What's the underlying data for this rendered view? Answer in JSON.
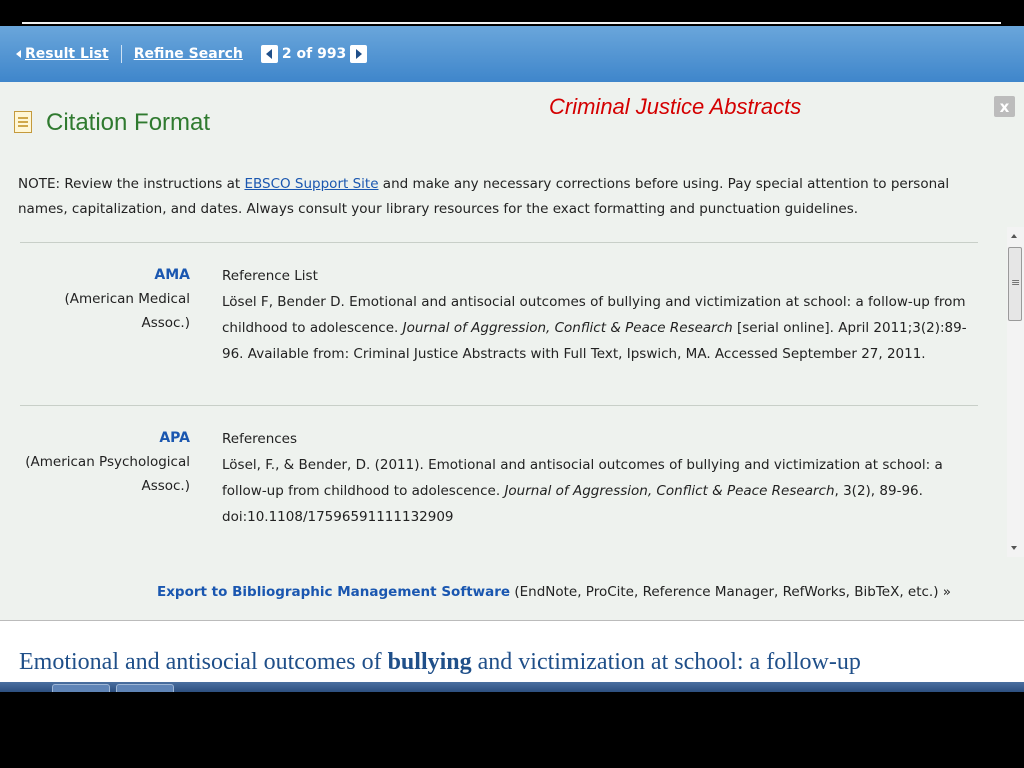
{
  "nav": {
    "result_list": "Result List",
    "refine_search": "Refine Search",
    "pager": "2 of 993"
  },
  "header": {
    "title": "Citation Format",
    "database": "Criminal Justice Abstracts",
    "close_label": "x"
  },
  "note": {
    "prefix": "NOTE: Review the instructions at ",
    "link": "EBSCO Support Site",
    "suffix": " and make any necessary corrections before using. Pay special attention to personal names, capitalization, and dates. Always consult your library resources for the exact formatting and punctuation guidelines."
  },
  "citations": [
    {
      "style": "AMA",
      "style_full": "(American Medical Assoc.)",
      "heading": "Reference List",
      "text_before": "Lösel F, Bender D. Emotional and antisocial outcomes of bullying and victimization at school: a follow-up from childhood to adolescence. ",
      "journal": "Journal of Aggression, Conflict & Peace Research",
      "text_after": " [serial online]. April 2011;3(2):89-96. Available from: Criminal Justice Abstracts with Full Text, Ipswich, MA. Accessed September 27, 2011."
    },
    {
      "style": "APA",
      "style_full": "(American Psychological Assoc.)",
      "heading": "References",
      "text_before": "Lösel, F., & Bender, D. (2011). Emotional and antisocial outcomes of bullying and victimization at school: a follow-up from childhood to adolescence. ",
      "journal": "Journal of Aggression, Conflict & Peace Research",
      "text_after": ", 3(2), 89-96. doi:10.1108/17596591111132909"
    }
  ],
  "export": {
    "link": "Export to Bibliographic Management Software",
    "suffix": " (EndNote, ProCite, Reference Manager, RefWorks, BibTeX, etc.) »"
  },
  "article": {
    "title_before": "Emotional and antisocial outcomes of ",
    "title_bold": "bullying",
    "title_after": " and victimization at school: a follow-up"
  }
}
